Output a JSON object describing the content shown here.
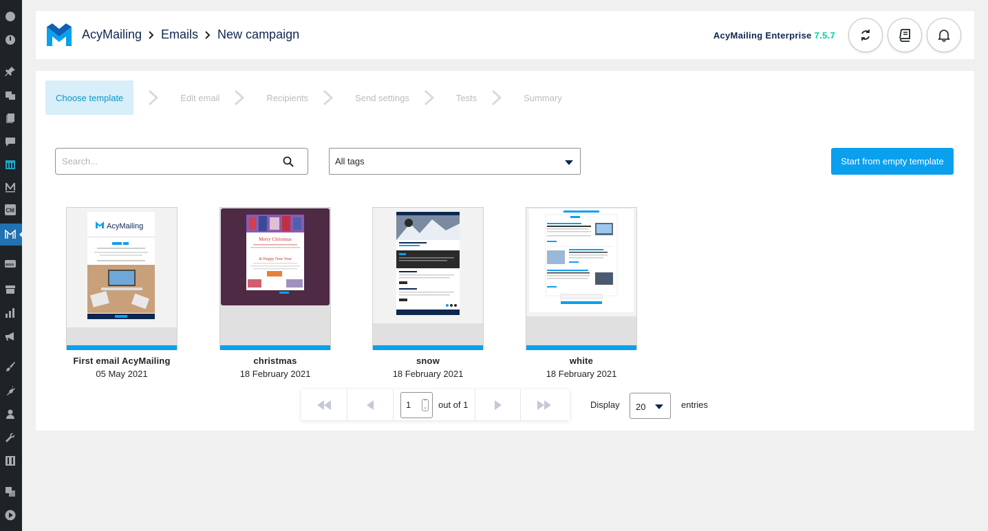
{
  "wp_sidebar": {
    "icons": [
      "dashboard-icon",
      "gauge-icon",
      "pin-icon",
      "media-icon",
      "pages-icon",
      "comments-icon",
      "calendar-icon",
      "m-letter-icon",
      "cm-icon",
      "acymailing-icon",
      "woo-icon",
      "archive-icon",
      "stats-icon",
      "megaphone-icon",
      "appearance-icon",
      "plugins-icon",
      "users-icon",
      "tools-icon",
      "settings-icon",
      "translate-icon",
      "play-icon"
    ]
  },
  "header": {
    "breadcrumb": [
      "AcyMailing",
      "Emails",
      "New campaign"
    ],
    "edition_label": "AcyMailing Enterprise",
    "version": "7.5.7"
  },
  "steps": [
    "Choose template",
    "Edit email",
    "Recipients",
    "Send settings",
    "Tests",
    "Summary"
  ],
  "filters": {
    "search_placeholder": "Search...",
    "tags_selected": "All tags",
    "start_button": "Start from empty template"
  },
  "templates": [
    {
      "name": "First email AcyMailing",
      "date": "05 May 2021"
    },
    {
      "name": "christmas",
      "date": "18 February 2021"
    },
    {
      "name": "snow",
      "date": "18 February 2021"
    },
    {
      "name": "white",
      "date": "18 February 2021"
    }
  ],
  "pagination": {
    "current_page": "1",
    "out_of": "out of 1",
    "display_label": "Display",
    "per_page": "20",
    "entries_label": "entries"
  },
  "colors": {
    "accent": "#0aa0ee",
    "navy": "#0e2650",
    "version_green": "#00d3a3",
    "active_step_bg": "#d8eef8"
  }
}
